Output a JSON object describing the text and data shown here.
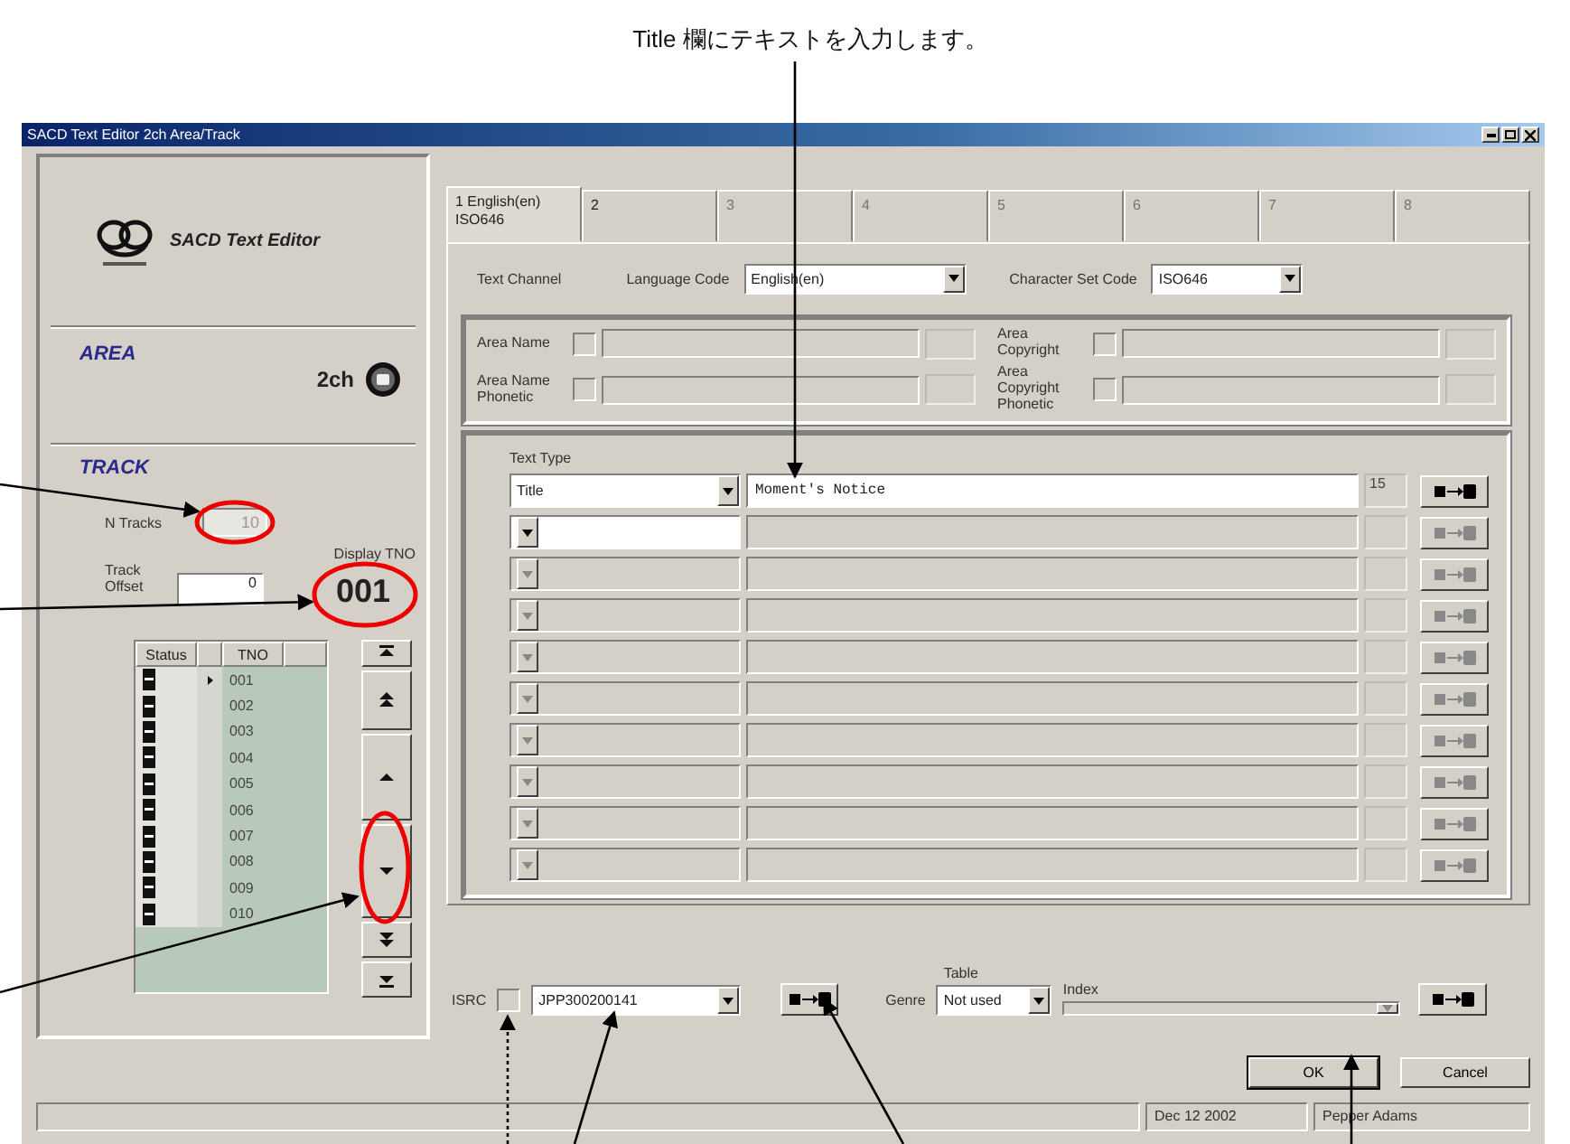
{
  "caption": "Title 欄にテキストを入力します。",
  "window": {
    "title": "SACD Text Editor 2ch Area/Track"
  },
  "logo": {
    "text": "SACD Text Editor"
  },
  "area": {
    "heading": "AREA",
    "channel": "2ch"
  },
  "track": {
    "heading": "TRACK",
    "n_tracks_label": "N Tracks",
    "n_tracks": "10",
    "display_tno_label": "Display TNO",
    "display_tno": "001",
    "offset_label": "Track Offset",
    "offset_value": "0"
  },
  "track_list": {
    "columns": [
      "Status",
      "TNO"
    ],
    "rows": [
      {
        "tno": "001",
        "current": true
      },
      {
        "tno": "002",
        "current": false
      },
      {
        "tno": "003",
        "current": false
      },
      {
        "tno": "004",
        "current": false
      },
      {
        "tno": "005",
        "current": false
      },
      {
        "tno": "006",
        "current": false
      },
      {
        "tno": "007",
        "current": false
      },
      {
        "tno": "008",
        "current": false
      },
      {
        "tno": "009",
        "current": false
      },
      {
        "tno": "010",
        "current": false
      }
    ]
  },
  "nav_buttons": [
    {
      "kind": "first"
    },
    {
      "kind": "page_up"
    },
    {
      "kind": "up"
    },
    {
      "kind": "down"
    },
    {
      "kind": "page_down"
    },
    {
      "kind": "last"
    }
  ],
  "tabs": [
    {
      "label": "1 English(en) ISO646",
      "selected": true,
      "disabled": false
    },
    {
      "label": "2",
      "selected": false,
      "disabled": false
    },
    {
      "label": "3",
      "selected": false,
      "disabled": true
    },
    {
      "label": "4",
      "selected": false,
      "disabled": true
    },
    {
      "label": "5",
      "selected": false,
      "disabled": true
    },
    {
      "label": "6",
      "selected": false,
      "disabled": true
    },
    {
      "label": "7",
      "selected": false,
      "disabled": true
    },
    {
      "label": "8",
      "selected": false,
      "disabled": true
    }
  ],
  "text_channel": {
    "label": "Text Channel",
    "language_label": "Language Code",
    "language": "English(en)",
    "charset_label": "Character Set Code",
    "charset": "ISO646"
  },
  "area_fields": [
    {
      "label": "Area Name",
      "checked": false
    },
    {
      "label": "Area Copyright",
      "checked": false
    },
    {
      "label": "Area Name Phonetic",
      "checked": false
    },
    {
      "label": "Area Copyright Phonetic",
      "checked": false
    }
  ],
  "text_type_label": "Text Type",
  "text_rows": [
    {
      "type": "Title",
      "text": "Moment's Notice",
      "count": "15",
      "enabled": true
    },
    {
      "enabled": true
    },
    {
      "enabled": false
    },
    {
      "enabled": false
    },
    {
      "enabled": false
    },
    {
      "enabled": false
    },
    {
      "enabled": false
    },
    {
      "enabled": false
    },
    {
      "enabled": false
    },
    {
      "enabled": false
    }
  ],
  "isrc": {
    "label": "ISRC",
    "value": "JPP300200141",
    "checked": false
  },
  "genre": {
    "label": "Genre",
    "table_label": "Table",
    "table_value": "Not used",
    "index_label": "Index"
  },
  "buttons": [
    "OK",
    "Cancel"
  ],
  "status_bar": [
    "Dec 12 2002",
    "Pepper Adams"
  ]
}
